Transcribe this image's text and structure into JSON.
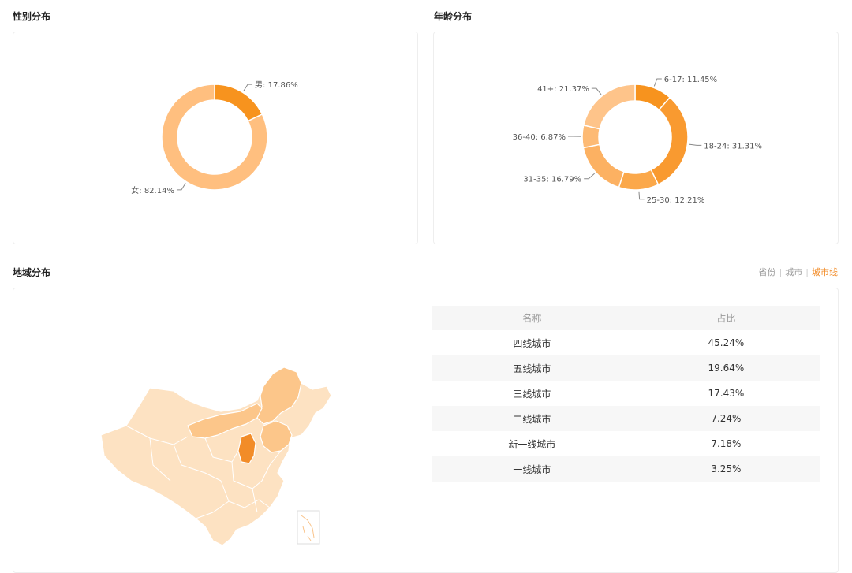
{
  "gender": {
    "title": "性别分布",
    "chart_data": {
      "type": "pie",
      "slices": [
        {
          "label": "男",
          "value": 17.86,
          "text": "男: 17.86%",
          "color": "#f7931e"
        },
        {
          "label": "女",
          "value": 82.14,
          "text": "女: 82.14%",
          "color": "#ffbf7f"
        }
      ]
    }
  },
  "age": {
    "title": "年龄分布",
    "chart_data": {
      "type": "pie",
      "slices": [
        {
          "label": "6-17",
          "value": 11.45,
          "text": "6-17: 11.45%",
          "color": "#f7931e"
        },
        {
          "label": "18-24",
          "value": 31.31,
          "text": "18-24: 31.31%",
          "color": "#f99a30"
        },
        {
          "label": "25-30",
          "value": 12.21,
          "text": "25-30: 12.21%",
          "color": "#fba84a"
        },
        {
          "label": "31-35",
          "value": 16.79,
          "text": "31-35: 16.79%",
          "color": "#fcb162"
        },
        {
          "label": "36-40",
          "value": 6.87,
          "text": "36-40: 6.87%",
          "color": "#fdba74"
        },
        {
          "label": "41+",
          "value": 21.37,
          "text": "41+: 21.37%",
          "color": "#fec48a"
        }
      ]
    }
  },
  "region": {
    "title": "地域分布",
    "tabs": [
      {
        "label": "省份",
        "active": false
      },
      {
        "label": "城市",
        "active": false
      },
      {
        "label": "城市线",
        "active": true
      }
    ],
    "table": {
      "headers": [
        "名称",
        "占比"
      ],
      "rows": [
        {
          "name": "四线城市",
          "pct": "45.24%"
        },
        {
          "name": "五线城市",
          "pct": "19.64%"
        },
        {
          "name": "三线城市",
          "pct": "17.43%"
        },
        {
          "name": "二线城市",
          "pct": "7.24%"
        },
        {
          "name": "新一线城市",
          "pct": "7.18%"
        },
        {
          "name": "一线城市",
          "pct": "3.25%"
        }
      ]
    },
    "map_colors": {
      "base": "#fde2c2",
      "medium": "#fcc68a",
      "strong": "#f28c28"
    }
  }
}
